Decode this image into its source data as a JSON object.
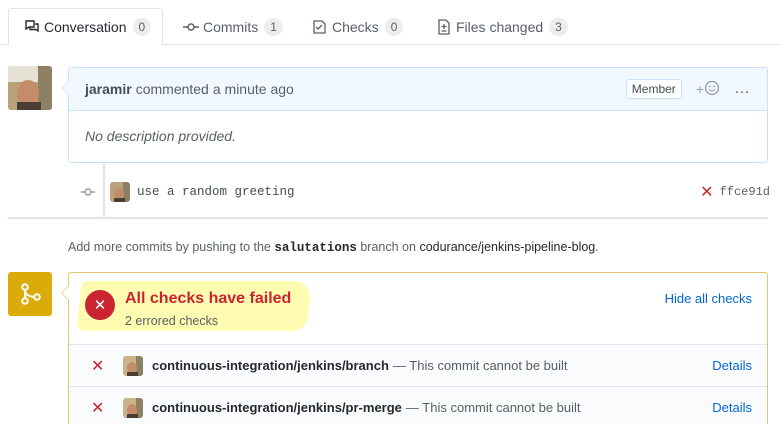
{
  "tabs": [
    {
      "label": "Conversation",
      "count": "0",
      "icon": "comment-discussion-icon",
      "selected": true
    },
    {
      "label": "Commits",
      "count": "1",
      "icon": "git-commit-icon",
      "selected": false
    },
    {
      "label": "Checks",
      "count": "0",
      "icon": "checklist-icon",
      "selected": false
    },
    {
      "label": "Files changed",
      "count": "3",
      "icon": "file-diff-icon",
      "selected": false
    }
  ],
  "comment": {
    "author": "jaramir",
    "action": "commented",
    "time": "a minute ago",
    "badge": "Member",
    "body": "No description provided.",
    "react_plus": "+",
    "more": "…"
  },
  "commit": {
    "message": "use a random greeting",
    "status_icon": "x-icon",
    "sha": "ffce91d"
  },
  "push_hint": {
    "prefix": "Add more commits by pushing to the",
    "branch": "salutations",
    "middle": "branch on",
    "repo": "codurance/jenkins-pipeline-blog",
    "suffix": "."
  },
  "checks": {
    "title": "All checks have failed",
    "subtitle": "2 errored checks",
    "hide_label": "Hide all checks",
    "items": [
      {
        "name": "continuous-integration/jenkins/branch",
        "desc": "— This commit cannot be built",
        "details": "Details"
      },
      {
        "name": "continuous-integration/jenkins/pr-merge",
        "desc": "— This commit cannot be built",
        "details": "Details"
      }
    ]
  },
  "colors": {
    "fail": "#cb2431",
    "link": "#0366d6",
    "merge_icon_bg": "#dbab09",
    "highlight": "#fffbb0",
    "comment_header_bg": "#f1f8ff"
  }
}
